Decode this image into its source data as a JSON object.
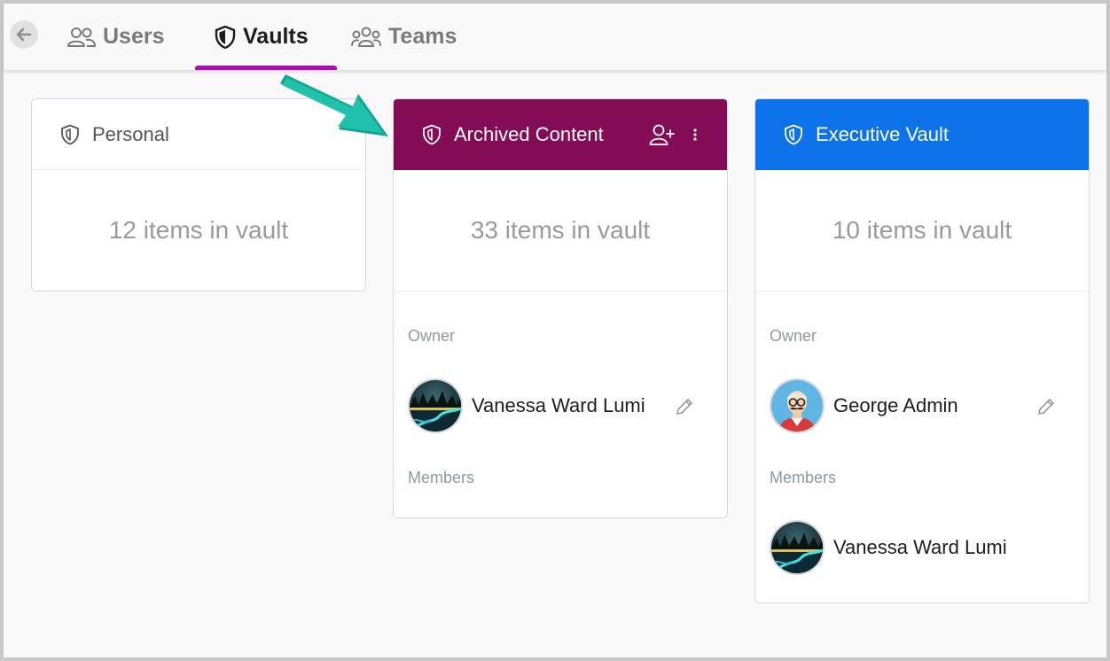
{
  "tabs": [
    {
      "label": "Users",
      "icon": "users-icon"
    },
    {
      "label": "Vaults",
      "icon": "shield-icon"
    },
    {
      "label": "Teams",
      "icon": "teams-icon"
    }
  ],
  "active_tab": "Vaults",
  "colors": {
    "accent": "#b10ab1",
    "archived_header": "#830c54",
    "executive_header": "#0d73ea",
    "callout_arrow": "#1bb3a0"
  },
  "vaults": [
    {
      "name": "Personal",
      "count_text": "12 items in vault"
    },
    {
      "name": "Archived Content",
      "count_text": "33 items in vault",
      "owner_label": "Owner",
      "owner": "Vanessa Ward Lumi",
      "members_label": "Members"
    },
    {
      "name": "Executive Vault",
      "count_text": "10 items in vault",
      "owner_label": "Owner",
      "owner": "George Admin",
      "members_label": "Members",
      "members": [
        "Vanessa Ward Lumi"
      ]
    }
  ]
}
